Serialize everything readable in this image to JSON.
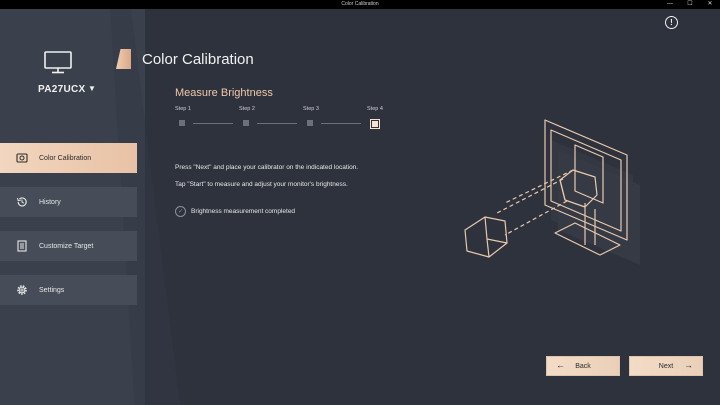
{
  "window": {
    "title": "Color Calibration",
    "minimize": "—",
    "maximize": "☐",
    "close": "✕"
  },
  "sidebar": {
    "model": "PA27UCX",
    "items": [
      {
        "label": "Color Calibration",
        "icon": "calibration-icon",
        "active": true
      },
      {
        "label": "History",
        "icon": "history-icon",
        "active": false
      },
      {
        "label": "Customize Target",
        "icon": "document-icon",
        "active": false
      },
      {
        "label": "Settings",
        "icon": "gear-icon",
        "active": false
      }
    ]
  },
  "header": {
    "title": "Color Calibration",
    "info": "!"
  },
  "section": {
    "title": "Measure Brightness"
  },
  "steps": [
    {
      "label": "Step 1",
      "current": false
    },
    {
      "label": "Step 2",
      "current": false
    },
    {
      "label": "Step 3",
      "current": false
    },
    {
      "label": "Step 4",
      "current": true
    }
  ],
  "instructions": [
    "Press \"Next\" and place your calibrator on the indicated location.",
    "Tap \"Start\" to measure and adjust your monitor's brightness."
  ],
  "status": {
    "text": "Brightness measurement completed",
    "check": "✓"
  },
  "buttons": {
    "back": "Back",
    "next": "Next",
    "back_arrow": "←",
    "next_arrow": "→"
  },
  "colors": {
    "accent": "#f0cdb0",
    "sidebar": "#3b414c",
    "background": "#2d323d"
  }
}
